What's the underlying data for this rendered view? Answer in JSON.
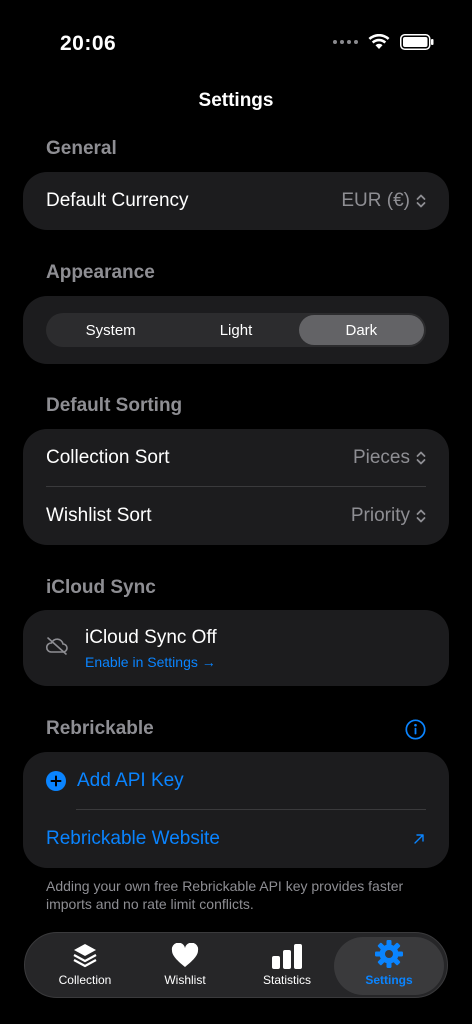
{
  "status": {
    "time": "20:06"
  },
  "nav": {
    "title": "Settings"
  },
  "general": {
    "header": "General",
    "currency_label": "Default Currency",
    "currency_value": "EUR (€)"
  },
  "appearance": {
    "header": "Appearance",
    "options": [
      "System",
      "Light",
      "Dark"
    ],
    "selected": "Dark"
  },
  "sorting": {
    "header": "Default Sorting",
    "collection_label": "Collection Sort",
    "collection_value": "Pieces",
    "wishlist_label": "Wishlist Sort",
    "wishlist_value": "Priority"
  },
  "icloud": {
    "header": "iCloud Sync",
    "title": "iCloud Sync Off",
    "link": "Enable in Settings →"
  },
  "rebrickable": {
    "header": "Rebrickable",
    "add_api_key": "Add API Key",
    "website": "Rebrickable Website",
    "footer": "Adding your own free Rebrickable API key provides faster imports and no rate limit conflicts."
  },
  "tabs": [
    {
      "label": "Collection",
      "icon": "stack-icon"
    },
    {
      "label": "Wishlist",
      "icon": "heart-icon"
    },
    {
      "label": "Statistics",
      "icon": "bar-chart-icon"
    },
    {
      "label": "Settings",
      "icon": "gear-icon"
    }
  ],
  "tabs_selected": "Settings",
  "colors": {
    "accent": "#0a84ff",
    "card": "#1c1c1e",
    "background": "#000000",
    "secondary_text": "#8e8e93"
  }
}
